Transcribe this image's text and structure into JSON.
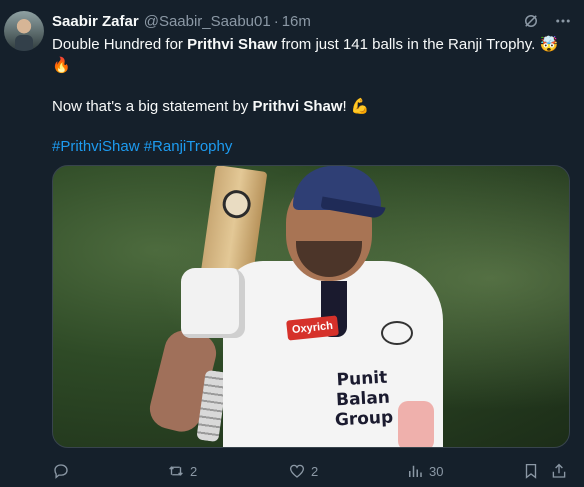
{
  "tweet": {
    "author_name": "Saabir Zafar",
    "handle": "@Saabir_Saabu01",
    "separator": "·",
    "time": "16m",
    "line1_pre": "Double Hundred for ",
    "line1_bold": "Prithvi Shaw",
    "line1_post": " from just 141 balls in the Ranji Trophy.",
    "emoji_head": "🤯",
    "emoji_fire": "🔥",
    "line2_pre": "Now that's a big statement by ",
    "line2_bold": "Prithvi Shaw",
    "line2_post": "!",
    "emoji_flex": "💪",
    "hashtags": [
      "#PrithviShaw",
      "#RanjiTrophy"
    ]
  },
  "media": {
    "sponsor_left": "Oxyrich",
    "jersey_text_line1": "Punit Balan",
    "jersey_text_line2": "Group"
  },
  "actions": {
    "replies": "",
    "retweets": "2",
    "likes": "2",
    "views": "30"
  },
  "icons": {
    "header": [
      "grok-icon",
      "more-icon"
    ],
    "actions": [
      "reply-icon",
      "retweet-icon",
      "like-icon",
      "views-icon",
      "bookmark-icon",
      "share-icon"
    ]
  },
  "colors": {
    "background": "#15202b",
    "text": "#f7f9f9",
    "muted": "#8b98a5",
    "link": "#1d9bf0"
  }
}
